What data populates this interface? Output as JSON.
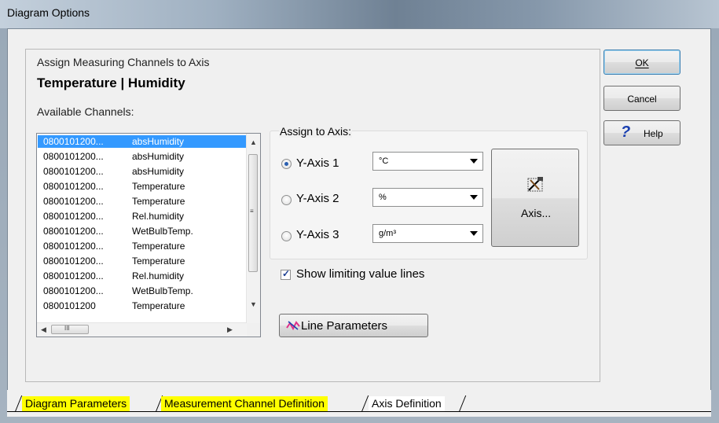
{
  "window": {
    "title": "Diagram Options"
  },
  "group": {
    "heading": "Assign Measuring Channels to Axis",
    "subheading": "Temperature | Humidity",
    "available_label": "Available Channels:"
  },
  "channels": [
    {
      "id": "0800101200...",
      "name": "absHumidity",
      "selected": true
    },
    {
      "id": "0800101200...",
      "name": "absHumidity"
    },
    {
      "id": "0800101200...",
      "name": "absHumidity"
    },
    {
      "id": "0800101200...",
      "name": "Temperature"
    },
    {
      "id": "0800101200...",
      "name": "Temperature"
    },
    {
      "id": "0800101200...",
      "name": "Rel.humidity"
    },
    {
      "id": "0800101200...",
      "name": "WetBulbTemp."
    },
    {
      "id": "0800101200...",
      "name": "Temperature"
    },
    {
      "id": "0800101200...",
      "name": "Temperature"
    },
    {
      "id": "0800101200...",
      "name": "Rel.humidity"
    },
    {
      "id": "0800101200...",
      "name": "WetBulbTemp."
    },
    {
      "id": "0800101200",
      "name": "Temperature"
    }
  ],
  "assign": {
    "label": "Assign to Axis:",
    "axes": [
      {
        "label": "Y-Axis 1",
        "unit": "°C",
        "checked": true
      },
      {
        "label": "Y-Axis 2",
        "unit": "%",
        "checked": false
      },
      {
        "label": "Y-Axis 3",
        "unit": "g/m³",
        "checked": false
      }
    ],
    "axis_button": "Axis..."
  },
  "show_limiting": {
    "label": "Show limiting value lines",
    "checked": true
  },
  "line_params_button": "Line Parameters",
  "buttons": {
    "ok": "OK",
    "cancel": "Cancel",
    "help": "Help"
  },
  "tabs": [
    "Diagram Parameters",
    "Measurement Channel Definition",
    "Axis Definition"
  ],
  "scroll_glyph": "III",
  "help_glyph": "?"
}
